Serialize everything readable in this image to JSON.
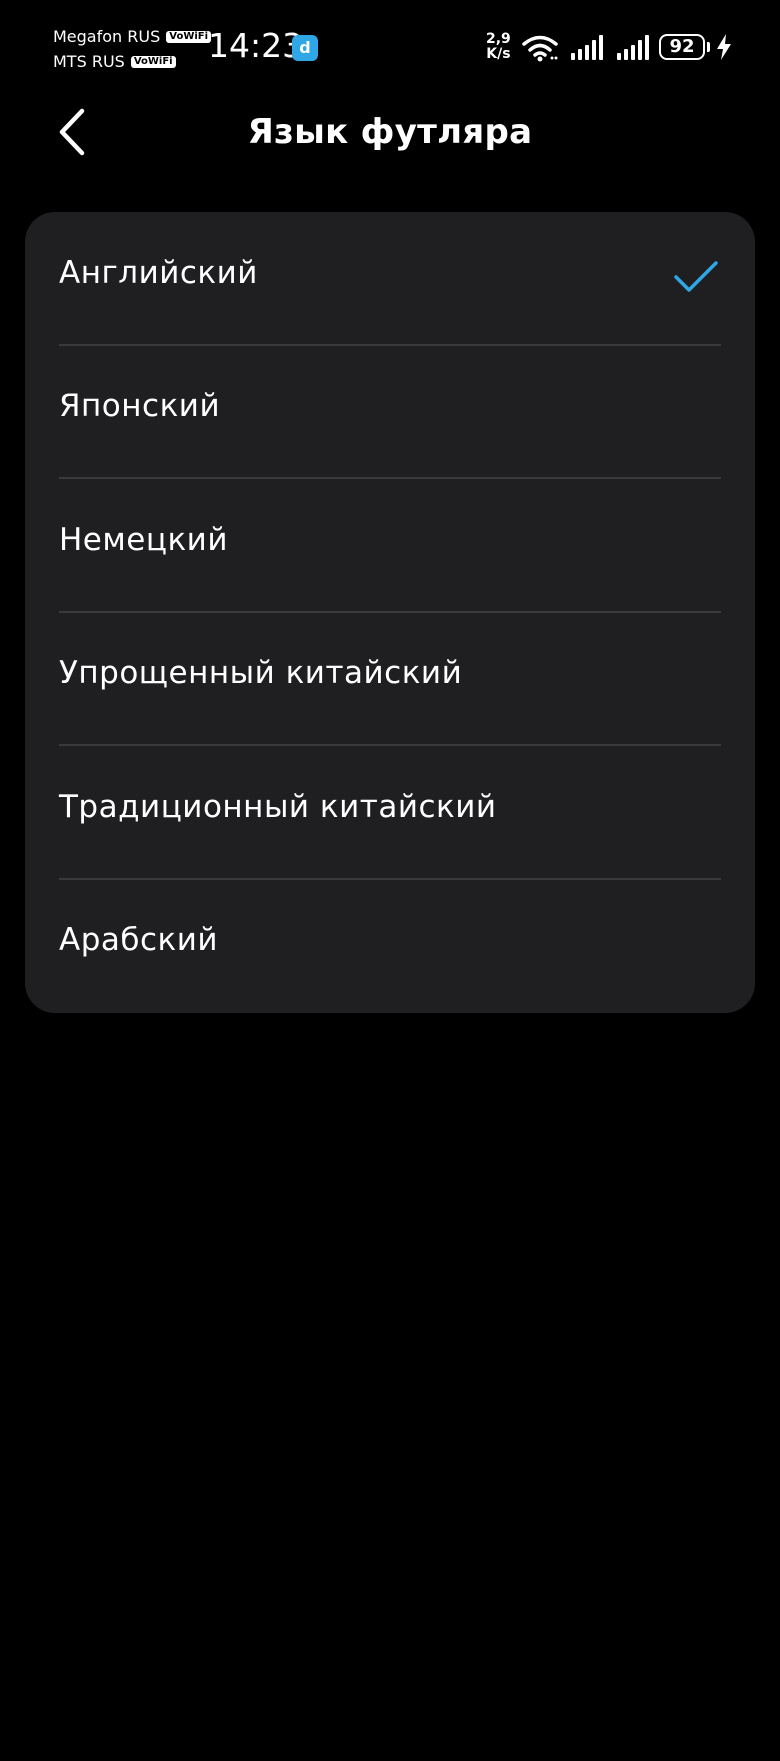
{
  "status_bar": {
    "carrier_1": "Megafon RUS",
    "carrier_2": "MTS RUS",
    "vowifi_label": "VoWiFi",
    "time": "14:23",
    "app_badge": "d",
    "net_speed_value": "2,9",
    "net_speed_unit": "K/s",
    "battery_level": "92",
    "icons": [
      "wifi-icon",
      "signal-icon",
      "signal-icon",
      "battery-icon",
      "charging-bolt-icon"
    ]
  },
  "header": {
    "title": "Язык футляра",
    "back_icon": "chevron-left-icon"
  },
  "languages": [
    {
      "label": "Английский",
      "selected": true
    },
    {
      "label": "Японский",
      "selected": false
    },
    {
      "label": "Немецкий",
      "selected": false
    },
    {
      "label": "Упрощенный китайский",
      "selected": false
    },
    {
      "label": "Традиционный китайский",
      "selected": false
    },
    {
      "label": "Арабский",
      "selected": false
    }
  ],
  "colors": {
    "background": "#000000",
    "card": "#1f1f22",
    "divider": "#3a3a3e",
    "accent_check": "#2fa6e6",
    "text": "#ffffff"
  }
}
